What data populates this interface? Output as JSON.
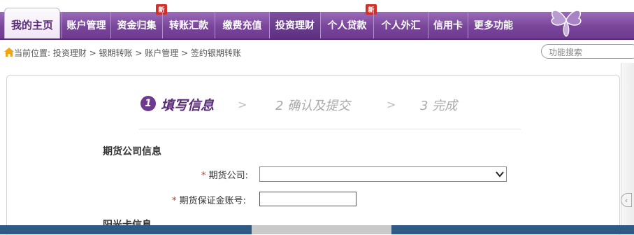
{
  "nav": {
    "home": "我的主页",
    "tabs": [
      {
        "label": "账户管理"
      },
      {
        "label": "资金归集",
        "badge": "新"
      },
      {
        "label": "转账汇款"
      },
      {
        "label": "缴费充值"
      },
      {
        "label": "投资理财",
        "active": true
      },
      {
        "label": "个人贷款",
        "badge": "新"
      },
      {
        "label": "个人外汇"
      },
      {
        "label": "信用卡"
      },
      {
        "label": "更多功能"
      }
    ]
  },
  "breadcrumb": {
    "text": "当前位置: 投资理财 > 银期转账 > 账户管理 > 签约银期转账"
  },
  "search": {
    "placeholder": "功能搜索"
  },
  "steps": {
    "step1_num": "1",
    "step1": "填写信息",
    "separator": ">",
    "step2": "2 确认及提交",
    "step3": "3 完成"
  },
  "form": {
    "section1_title": "期货公司信息",
    "required_mark": "*",
    "company_label": "期货公司:",
    "margin_account_label": "期货保证金账号:",
    "section2_title": "阳光卡信息"
  },
  "colors": {
    "nav_purple": "#7a469b",
    "active_tab": "#5d2f80",
    "badge_red": "#d0312a",
    "required_red": "#c0392b"
  }
}
